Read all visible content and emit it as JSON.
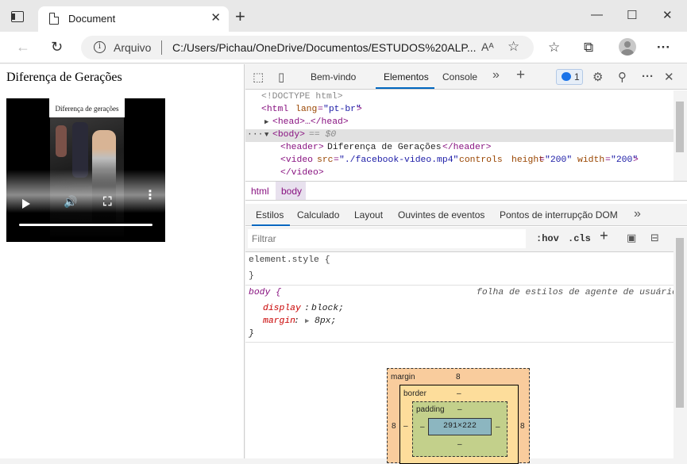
{
  "browser": {
    "tab_title": "Document",
    "tab_close": "✕",
    "new_tab": "+",
    "window": {
      "minimize": "—",
      "maximize": "☐",
      "close": "✕"
    },
    "address": {
      "security_label": "Arquivo",
      "info_glyph": "i",
      "url": "C:/Users/Pichau/OneDrive/Documentos/ESTUDOS%20ALP...",
      "read_aloud": "Aᴬ"
    },
    "nav": {
      "back": "←",
      "refresh": "↻"
    },
    "toolbar_icons": {
      "favorites": "☆",
      "star_add": "☆",
      "collections": "⧉",
      "more": "···"
    }
  },
  "page": {
    "header_text": "Diferença de Gerações",
    "video_caption": "Diferença de gerações",
    "video_controls": {
      "volume": "🔊",
      "fullscreen": "⛶",
      "more": "⋮"
    }
  },
  "devtools": {
    "tabs": [
      "Bem-vindo",
      "Elementos",
      "Console"
    ],
    "active_tab": "Elementos",
    "more_tabs": "»",
    "add_tab": "+",
    "issues_count": "1",
    "dom_lines": {
      "doctype": "<!DOCTYPE html>",
      "html_open_tag": "<html",
      "html_attr": "lang",
      "html_attr_val": "\"pt-br\"",
      "html_close_bracket": ">",
      "head": "<head>…</head>",
      "body_tag": "<body>",
      "body_eq": "== $0",
      "header_open": "<header>",
      "header_text": "Diferença de Gerações",
      "header_close": "</header>",
      "video_open": "<video",
      "video_src_attr": "src",
      "video_src_val": "\"./facebook-video.mp4\"",
      "video_controls": "controls",
      "video_height_attr": "height",
      "video_height_val": "\"200\"",
      "video_width_attr": "width",
      "video_width_val": "\"200\"",
      "video_end": ">",
      "video_close": "</video>",
      "dots": "···"
    },
    "breadcrumbs": [
      "html",
      "body"
    ],
    "style_tabs": [
      "Estilos",
      "Calculado",
      "Layout",
      "Ouvintes de eventos",
      "Pontos de interrupção DOM"
    ],
    "active_style_tab": "Estilos",
    "filter_placeholder": "Filtrar",
    "filter_buttons": {
      "hov": ":hov",
      "cls": ".cls",
      "add": "+"
    },
    "rules": {
      "element_style": "element.style {",
      "element_close": "}",
      "body_selector": "body {",
      "body_origin": "folha de estilos de agente de usuário",
      "display_prop": "display",
      "display_val": "block;",
      "margin_prop": "margin",
      "margin_val": "8px;",
      "body_close": "}"
    },
    "box_model": {
      "margin_label": "margin",
      "margin_top": "8",
      "margin_left": "8",
      "margin_right": "8",
      "border_label": "border",
      "border_top": "–",
      "border_left": "–",
      "padding_label": "padding",
      "padding_top": "–",
      "padding_left": "–",
      "padding_right": "–",
      "padding_bottom": "–",
      "content": "291×222"
    }
  }
}
